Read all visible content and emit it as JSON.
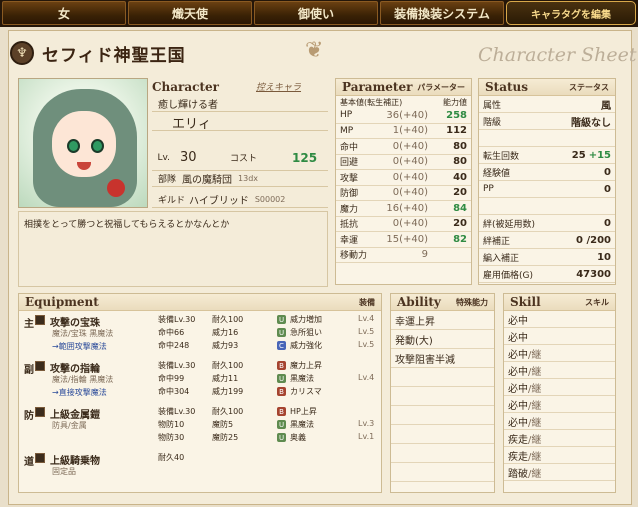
{
  "tabs": [
    "女",
    "熾天使",
    "御使い",
    "装備換装システム",
    "キャラタグを編集"
  ],
  "page_title": "セフィド神聖王国",
  "watermark": "Character Sheet",
  "character": {
    "header_en": "Character",
    "header_tag": "控えキャラ",
    "subtitle": "癒し輝ける者",
    "name": "エリィ",
    "lv_label": "Lv.",
    "lv": "30",
    "cost_label": "コスト",
    "cost": "125",
    "unit_label": "部隊",
    "unit": "風の魔騎団",
    "unit_lv": "13dx",
    "guild_label": "ギルド",
    "guild": "ハイブリッド",
    "guild_code": "S00002",
    "intro": "相撲をとって勝つと祝福してもらえるとかなんとか"
  },
  "parameter": {
    "header_en": "Parameter",
    "header_jp": "パラメーター",
    "col1": "基本値(転生補正)",
    "col2": "能力値",
    "rows": [
      {
        "name": "HP",
        "base": "36(+40)",
        "value": "258",
        "green": true
      },
      {
        "name": "MP",
        "base": "1(+40)",
        "value": "112"
      },
      {
        "name": "命中",
        "base": "0(+40)",
        "value": "80"
      },
      {
        "name": "回避",
        "base": "0(+40)",
        "value": "80"
      },
      {
        "name": "攻撃",
        "base": "0(+40)",
        "value": "40"
      },
      {
        "name": "防御",
        "base": "0(+40)",
        "value": "20"
      },
      {
        "name": "魔力",
        "base": "16(+40)",
        "value": "84",
        "green": true
      },
      {
        "name": "抵抗",
        "base": "0(+40)",
        "value": "20"
      },
      {
        "name": "幸運",
        "base": "15(+40)",
        "value": "82",
        "green": true
      },
      {
        "name": "移動力",
        "base": "9",
        "value": ""
      }
    ]
  },
  "status": {
    "header_en": "Status",
    "header_jp": "ステータス",
    "rows": [
      {
        "name": "属性",
        "value": "風"
      },
      {
        "name": "階級",
        "value": "階級なし"
      },
      {
        "name": "",
        "value": ""
      },
      {
        "name": "転生回数",
        "value": "25",
        "extra": "+15"
      },
      {
        "name": "経験値",
        "value": "0"
      },
      {
        "name": "PP",
        "value": "0"
      },
      {
        "name": "",
        "value": ""
      },
      {
        "name": "絆(被延用数)",
        "value": "0"
      },
      {
        "name": "絆補正",
        "value": "0 /200"
      },
      {
        "name": "編入補正",
        "value": "10"
      },
      {
        "name": "雇用価格(G)",
        "value": "47300"
      }
    ]
  },
  "equipment": {
    "header_en": "Equipment",
    "header_jp": "装備",
    "items": [
      {
        "slot": "主",
        "name": "攻撃の宝珠",
        "sub": "魔法/宝珠 黒魔法",
        "link": "→範囲攻撃魔法",
        "stats": [
          [
            "装備Lv.30",
            "耐久100"
          ],
          [
            "命中66",
            "威力16"
          ],
          [
            "命中248",
            "威力93"
          ]
        ],
        "skills": [
          [
            "U",
            "威力増加",
            "Lv.4"
          ],
          [
            "U",
            "急所狙い",
            "Lv.5"
          ],
          [
            "C",
            "威力強化",
            "Lv.5"
          ]
        ]
      },
      {
        "slot": "副",
        "name": "攻撃の指輪",
        "sub": "魔法/指輪 黒魔法",
        "link": "→直接攻撃魔法",
        "stats": [
          [
            "装備Lv.30",
            "耐久100"
          ],
          [
            "命中99",
            "威力11"
          ],
          [
            "命中304",
            "威力199"
          ]
        ],
        "skills": [
          [
            "B",
            "魔力上昇",
            ""
          ],
          [
            "U",
            "黒魔法",
            "Lv.4"
          ],
          [
            "B",
            "カリスマ",
            ""
          ]
        ]
      },
      {
        "slot": "防",
        "name": "上級金属鎧",
        "sub": "防具/金属",
        "link": "",
        "stats": [
          [
            "装備Lv.30",
            "耐久100"
          ],
          [
            "物防10",
            "魔防5"
          ],
          [
            "物防30",
            "魔防25"
          ]
        ],
        "skills": [
          [
            "B",
            "HP上昇",
            ""
          ],
          [
            "U",
            "黒魔法",
            "Lv.3"
          ],
          [
            "U",
            "奥義",
            "Lv.1"
          ]
        ]
      },
      {
        "slot": "道",
        "name": "上級騎乗物",
        "sub": "固定品",
        "link": "",
        "stats": [
          [
            "耐久40",
            ""
          ]
        ],
        "skills": []
      }
    ]
  },
  "ability": {
    "header_en": "Ability",
    "header_jp": "特殊能力",
    "items": [
      "幸運上昇",
      "発動(大)",
      "攻撃阻害半減",
      "",
      "",
      "",
      "",
      "",
      ""
    ]
  },
  "skill": {
    "header_en": "Skill",
    "header_jp": "スキル",
    "items": [
      [
        "必中",
        ""
      ],
      [
        "必中",
        ""
      ],
      [
        "必中",
        "/継"
      ],
      [
        "必中",
        "/継"
      ],
      [
        "必中",
        "/継"
      ],
      [
        "必中",
        "/継"
      ],
      [
        "必中",
        "/継"
      ],
      [
        "疾走",
        "/継"
      ],
      [
        "疾走",
        "/継"
      ],
      [
        "踏破",
        "/継"
      ]
    ]
  }
}
